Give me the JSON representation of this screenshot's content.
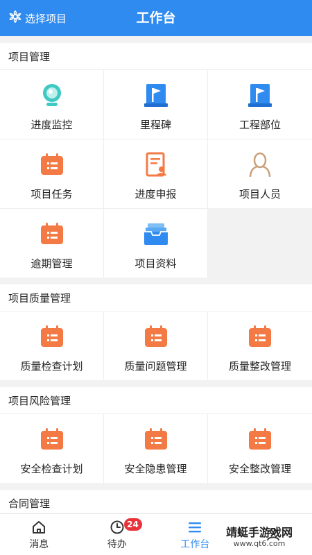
{
  "header": {
    "select_label": "选择项目",
    "title": "工作台"
  },
  "sections": {
    "project": {
      "title": "项目管理",
      "items": [
        {
          "label": "进度监控",
          "icon": "camera-icon"
        },
        {
          "label": "里程碑",
          "icon": "milestone-flag-icon"
        },
        {
          "label": "工程部位",
          "icon": "location-flag-icon"
        },
        {
          "label": "项目任务",
          "icon": "calendar-icon"
        },
        {
          "label": "进度申报",
          "icon": "report-document-icon"
        },
        {
          "label": "项目人员",
          "icon": "person-icon"
        },
        {
          "label": "逾期管理",
          "icon": "calendar-icon"
        },
        {
          "label": "项目资料",
          "icon": "inbox-tray-icon"
        }
      ]
    },
    "quality": {
      "title": "项目质量管理",
      "items": [
        {
          "label": "质量检查计划",
          "icon": "calendar-icon"
        },
        {
          "label": "质量问题管理",
          "icon": "calendar-icon"
        },
        {
          "label": "质量整改管理",
          "icon": "calendar-icon"
        }
      ]
    },
    "risk": {
      "title": "项目风险管理",
      "items": [
        {
          "label": "安全检查计划",
          "icon": "calendar-icon"
        },
        {
          "label": "安全隐患管理",
          "icon": "calendar-icon"
        },
        {
          "label": "安全整改管理",
          "icon": "calendar-icon"
        }
      ]
    },
    "contract": {
      "title": "合同管理"
    }
  },
  "tabbar": {
    "items": [
      {
        "label": "消息",
        "icon": "home-icon"
      },
      {
        "label": "待办",
        "icon": "clock-icon",
        "badge": "24"
      },
      {
        "label": "工作台",
        "icon": "menu-icon"
      },
      {
        "label": "",
        "icon": "user-icon"
      }
    ]
  },
  "watermark": {
    "text": "靖蜓手游戏网",
    "url": "www.qt6.com"
  },
  "colors": {
    "primary": "#2f8bf0",
    "orange": "#f47a45",
    "teal": "#3ec9c3",
    "badge": "#e8333a"
  }
}
